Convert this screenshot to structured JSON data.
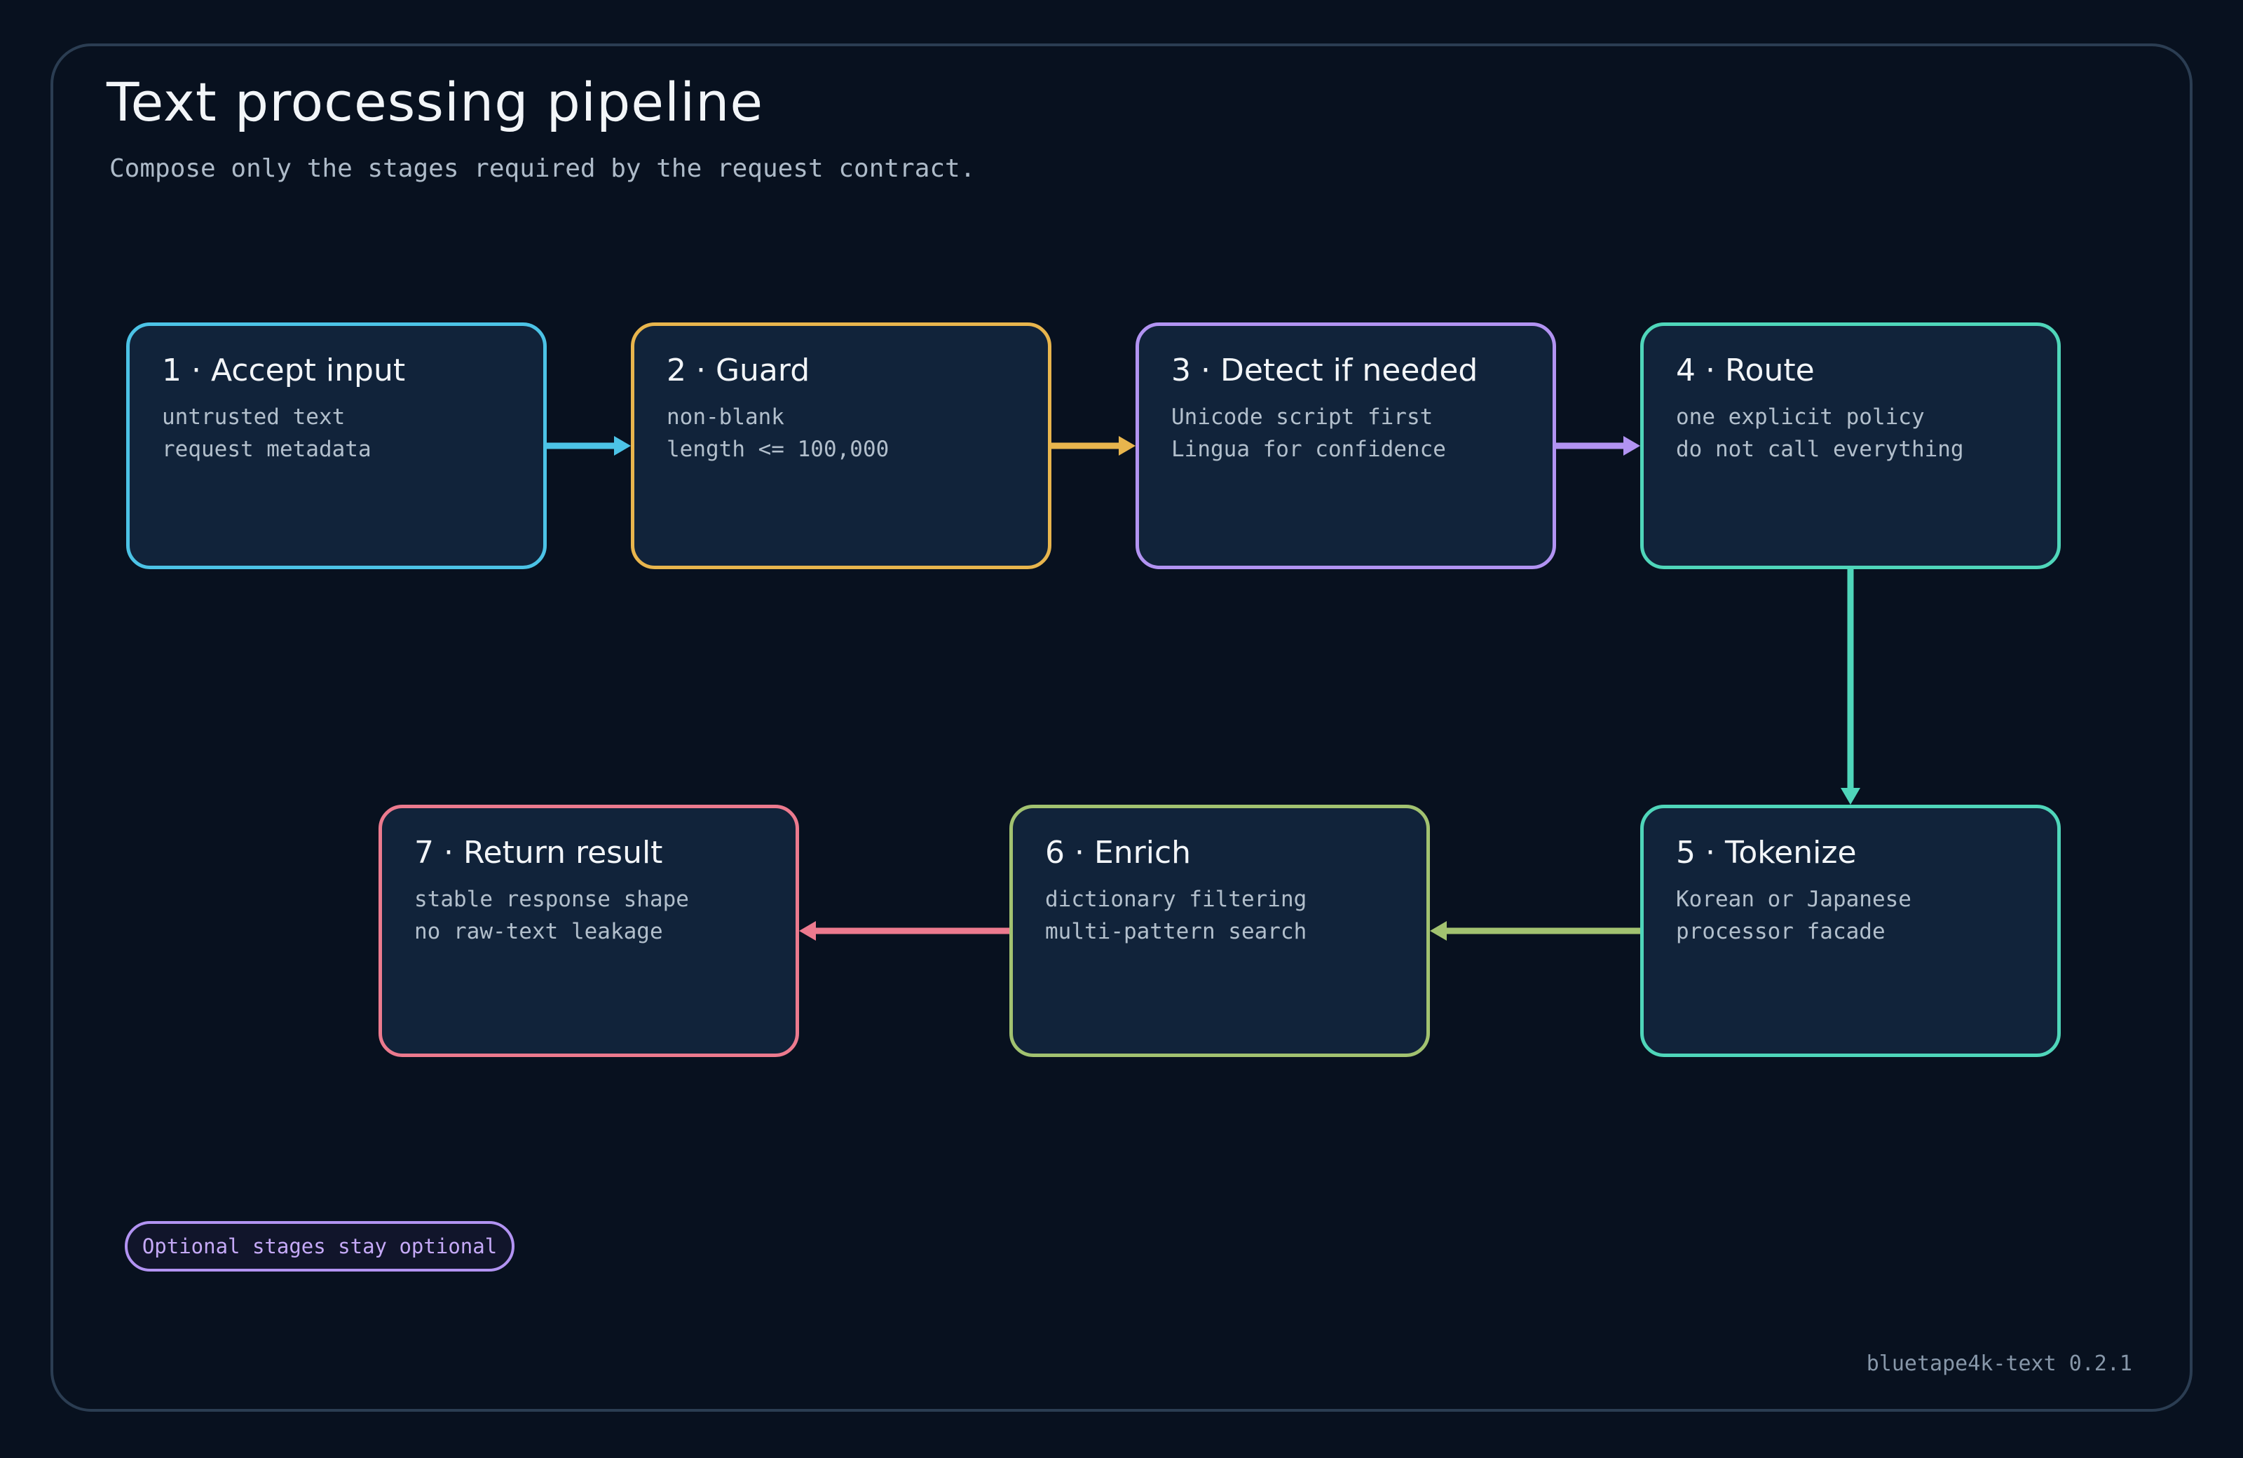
{
  "header": {
    "title": "Text processing pipeline",
    "subtitle": "Compose only the stages required by the request contract."
  },
  "stages": [
    {
      "title": "1 · Accept input",
      "lines": [
        "untrusted text",
        "request metadata"
      ],
      "color": "#4cc3e6"
    },
    {
      "title": "2 · Guard",
      "lines": [
        "non-blank",
        "length <= 100,000"
      ],
      "color": "#e8b54d"
    },
    {
      "title": "3 · Detect if needed",
      "lines": [
        "Unicode script first",
        "Lingua for confidence"
      ],
      "color": "#b293f2"
    },
    {
      "title": "4 · Route",
      "lines": [
        "one explicit policy",
        "do not call everything"
      ],
      "color": "#4fd6ba"
    },
    {
      "title": "5 · Tokenize",
      "lines": [
        "Korean or Japanese",
        "processor facade"
      ],
      "color": "#4fd6ba"
    },
    {
      "title": "6 · Enrich",
      "lines": [
        "dictionary filtering",
        "multi-pattern search"
      ],
      "color": "#a2c270"
    },
    {
      "title": "7 · Return result",
      "lines": [
        "stable response shape",
        "no raw-text leakage"
      ],
      "color": "#ec7a8e"
    }
  ],
  "edges": [
    {
      "from": 1,
      "to": 2,
      "color": "#4cc3e6"
    },
    {
      "from": 2,
      "to": 3,
      "color": "#e8b54d"
    },
    {
      "from": 3,
      "to": 4,
      "color": "#b293f2"
    },
    {
      "from": 4,
      "to": 5,
      "color": "#4fd6ba"
    },
    {
      "from": 5,
      "to": 6,
      "color": "#a2c270"
    },
    {
      "from": 6,
      "to": 7,
      "color": "#ec7a8e"
    }
  ],
  "note": {
    "label": "Optional stages stay optional"
  },
  "footer": {
    "version": "bluetape4k-text 0.2.1"
  }
}
